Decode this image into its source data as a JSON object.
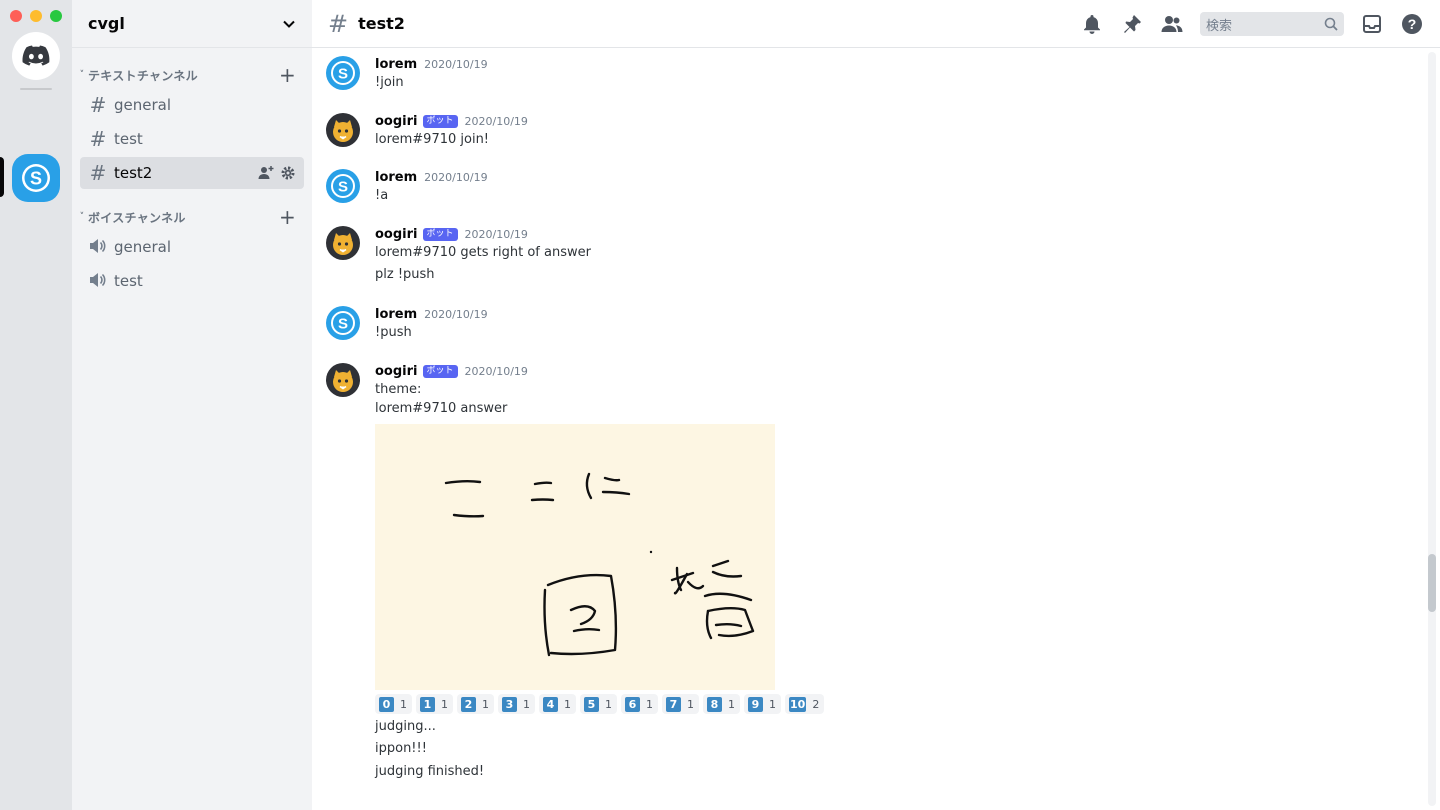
{
  "server": {
    "name": "cvgl"
  },
  "categories": {
    "text": {
      "label": "テキストチャンネル"
    },
    "voice": {
      "label": "ボイスチャンネル"
    }
  },
  "text_channels": [
    {
      "name": "general"
    },
    {
      "name": "test"
    },
    {
      "name": "test2"
    }
  ],
  "voice_channels": [
    {
      "name": "general"
    },
    {
      "name": "test"
    }
  ],
  "header": {
    "channel_name": "test2",
    "search_placeholder": "検索"
  },
  "messages": [
    {
      "author": "lorem",
      "time": "2020/10/19",
      "lines": [
        "!join"
      ]
    },
    {
      "author": "oogiri",
      "bot_tag": "ボット",
      "time": "2020/10/19",
      "lines": [
        "lorem#9710 join!"
      ]
    },
    {
      "author": "lorem",
      "time": "2020/10/19",
      "lines": [
        "!a"
      ]
    },
    {
      "author": "oogiri",
      "bot_tag": "ボット",
      "time": "2020/10/19",
      "lines": [
        "lorem#9710 gets right of answer",
        "plz !push"
      ]
    },
    {
      "author": "lorem",
      "time": "2020/10/19",
      "lines": [
        "!push"
      ]
    },
    {
      "author": "oogiri",
      "bot_tag": "ボット",
      "time": "2020/10/19",
      "lines": [
        "theme:",
        "lorem#9710 answer"
      ]
    }
  ],
  "followups": [
    "judging...",
    "ippon!!!",
    "judging finished!"
  ],
  "reactions": [
    {
      "emoji": "0",
      "count": "1"
    },
    {
      "emoji": "1",
      "count": "1"
    },
    {
      "emoji": "2",
      "count": "1"
    },
    {
      "emoji": "3",
      "count": "1"
    },
    {
      "emoji": "4",
      "count": "1"
    },
    {
      "emoji": "5",
      "count": "1"
    },
    {
      "emoji": "6",
      "count": "1"
    },
    {
      "emoji": "7",
      "count": "1"
    },
    {
      "emoji": "8",
      "count": "1"
    },
    {
      "emoji": "9",
      "count": "1"
    },
    {
      "emoji": "10",
      "count": "2"
    }
  ],
  "colors": {
    "accent": "#5865f2",
    "server_icon": "#29a0e7",
    "keycap": "#3b88c3",
    "drawing_bg": "#fdf6e3"
  },
  "icons": {
    "home": "discord-logo-icon",
    "server": "skype-logo-icon",
    "topbar": [
      "bell-icon",
      "pin-icon",
      "members-icon",
      "search-icon",
      "inbox-icon",
      "help-icon"
    ]
  }
}
